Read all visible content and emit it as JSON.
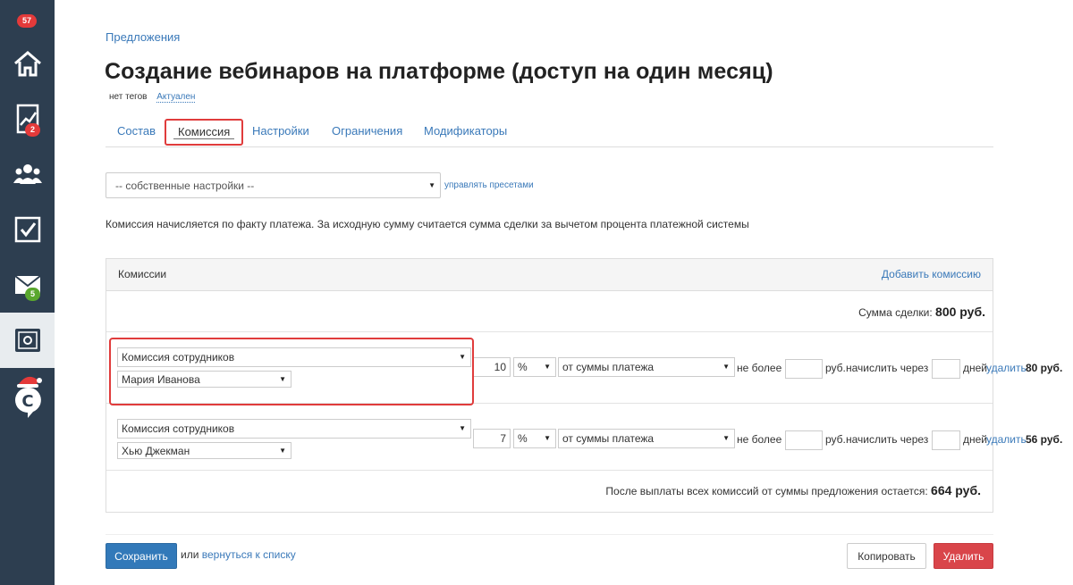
{
  "sidebar": {
    "badges": {
      "top": "57",
      "reports": "2",
      "mail": "5"
    }
  },
  "breadcrumb": "Предложения",
  "title": "Создание вебинаров на платформе (доступ на один месяц)",
  "tags": {
    "label": "нет тегов",
    "status": "Актуален"
  },
  "tabs": [
    "Состав",
    "Комиссия",
    "Настройки",
    "Ограничения",
    "Модификаторы"
  ],
  "preset": {
    "value": "-- собственные настройки --",
    "manage_link": "управлять пресетами"
  },
  "info_text": "Комиссия начисляется по факту платежа. За исходную сумму считается сумма сделки за вычетом процента платежной системы",
  "panel": {
    "title": "Комиссии",
    "add_link": "Добавить комиссию",
    "deal_sum_label": "Сумма сделки:",
    "deal_sum_value": "800 руб.",
    "remain_label": "После выплаты всех комиссий от суммы предложения остается:",
    "remain_value": "664 руб."
  },
  "commissions": [
    {
      "type": "Комиссия сотрудников",
      "employee": "Мария Иванова",
      "percent": "10",
      "unit": "%",
      "basis": "от суммы платежа",
      "max_label": "не более",
      "max_value": "",
      "currency_label": "руб.",
      "delay_label": "начислить через",
      "delay_value": "",
      "days_label": "дней",
      "delete_label": "удалить",
      "amount": "80 руб."
    },
    {
      "type": "Комиссия сотрудников",
      "employee": "Хью Джекман",
      "percent": "7",
      "unit": "%",
      "basis": "от суммы платежа",
      "max_label": "не более",
      "max_value": "",
      "currency_label": "руб.",
      "delay_label": "начислить через",
      "delay_value": "",
      "days_label": "дней",
      "delete_label": "удалить",
      "amount": "56 руб."
    }
  ],
  "footer": {
    "save": "Сохранить",
    "or": "или",
    "back_link": "вернуться к списку",
    "copy": "Копировать",
    "delete": "Удалить"
  },
  "colors": {
    "sidebar": "#2d3e50",
    "accent": "#3a79b9",
    "highlight": "#e03c3c",
    "danger": "#d9454a"
  }
}
